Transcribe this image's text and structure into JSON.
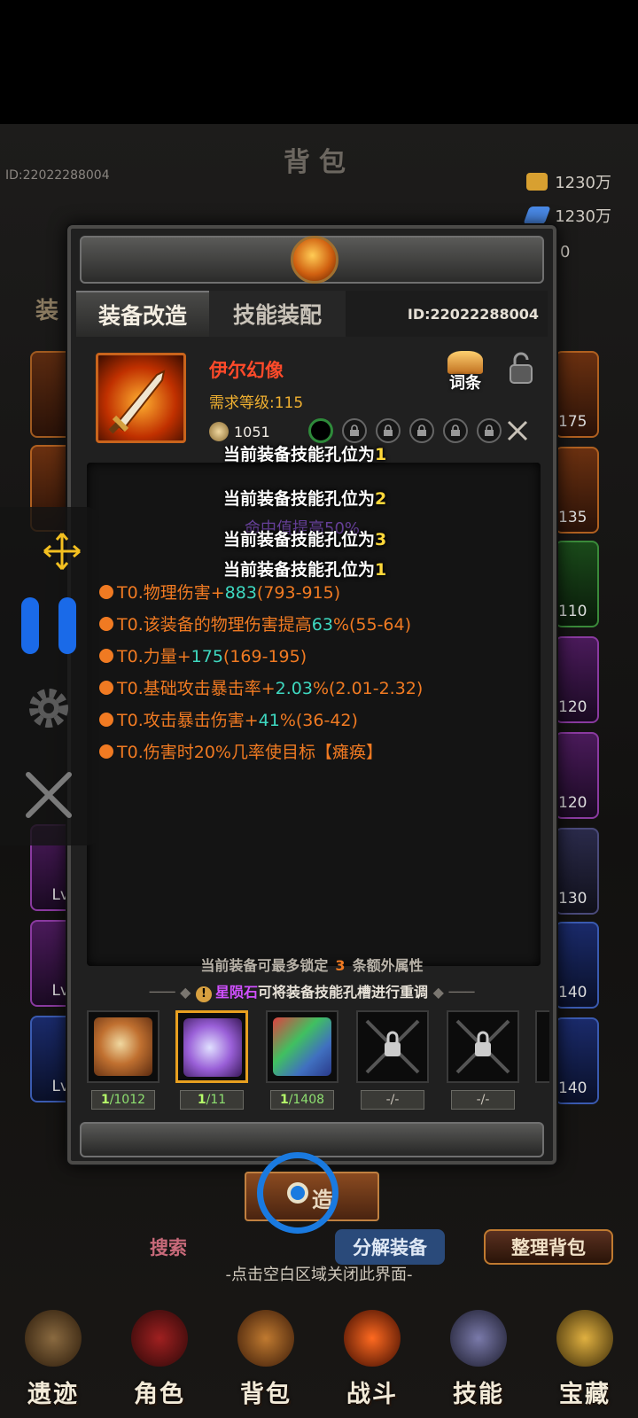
{
  "background": {
    "title": "背包",
    "player_id": "ID:22022288004",
    "currencies": [
      {
        "icon": "gold-icon",
        "amount": "1230万",
        "color": "#d8a030"
      },
      {
        "icon": "diamond-icon",
        "amount": "1230万",
        "color": "#4a8ae8"
      }
    ],
    "third_amount_fragment": "0",
    "tab_fragment": "装",
    "right_slot_levels": [
      "175",
      "135",
      "110",
      "120",
      "120",
      "130",
      "140",
      "140"
    ],
    "left_slot_level_prefix": "Lv",
    "search_label": "搜索",
    "decompose_label": "分解装备",
    "sort_label": "整理背包",
    "forge_label": "造"
  },
  "popup": {
    "tabs": [
      {
        "label": "装备改造",
        "active": true
      },
      {
        "label": "技能装配",
        "active": false
      }
    ],
    "equipment_id": "ID:22022288004",
    "item": {
      "name": "伊尔幻像",
      "requirement": "需求等级:115",
      "power": "1051",
      "affix_button": "词条",
      "socket_count": 6,
      "open_sockets": 1
    },
    "socket_messages": [
      {
        "text": "当前装备技能孔位为",
        "num": "1"
      },
      {
        "text": "当前装备技能孔位为",
        "num": "2"
      },
      {
        "text": "当前装备技能孔位为",
        "num": "3"
      },
      {
        "text": "当前装备技能孔位为",
        "num": "1"
      }
    ],
    "ghost_text": "命中值提高50%",
    "stats": [
      {
        "pre": "T0.物理伤害+",
        "val": "883",
        "post": "(793-915)"
      },
      {
        "pre": "T0.该装备的物理伤害提高",
        "val": "63",
        "post": "%(55-64)"
      },
      {
        "pre": "T0.力量+",
        "val": "175",
        "post": "(169-195)"
      },
      {
        "pre": "T0.基础攻击暴击率+",
        "val": "2.03",
        "post": "%(2.01-2.32)"
      },
      {
        "pre": "T0.攻击暴击伤害+",
        "val": "41",
        "post": "%(36-42)"
      },
      {
        "pre": "T0.伤害时20%几率使目标【瘫痪】",
        "val": "",
        "post": ""
      }
    ],
    "lock_note": {
      "pre": "当前装备可最多锁定",
      "num": "3",
      "post": "条额外属性"
    },
    "reset_note": {
      "stone": "星陨石",
      "post": "可将装备技能孔槽进行重调"
    },
    "materials": [
      {
        "name": "yin-yang-stone",
        "have": "1",
        "total": "/1012",
        "color": "#c07030"
      },
      {
        "name": "star-meteor-stone",
        "have": "1",
        "total": "/11",
        "color": "#9a60d8",
        "selected": true
      },
      {
        "name": "rainbow-crystal",
        "have": "1",
        "total": "/1408",
        "color": "#4070c0"
      },
      {
        "name": "locked-slot",
        "label": "-/-"
      },
      {
        "name": "locked-slot",
        "label": "-/-"
      }
    ]
  },
  "close_hint": "-点击空白区域关闭此界面-",
  "bottom_nav": [
    {
      "label": "遗迹",
      "color": "#8a6a40"
    },
    {
      "label": "角色",
      "color": "#a02020"
    },
    {
      "label": "背包",
      "color": "#c07a30"
    },
    {
      "label": "战斗",
      "color": "#d04020"
    },
    {
      "label": "技能",
      "color": "#5a5a8a"
    },
    {
      "label": "宝藏",
      "color": "#c09030"
    }
  ]
}
